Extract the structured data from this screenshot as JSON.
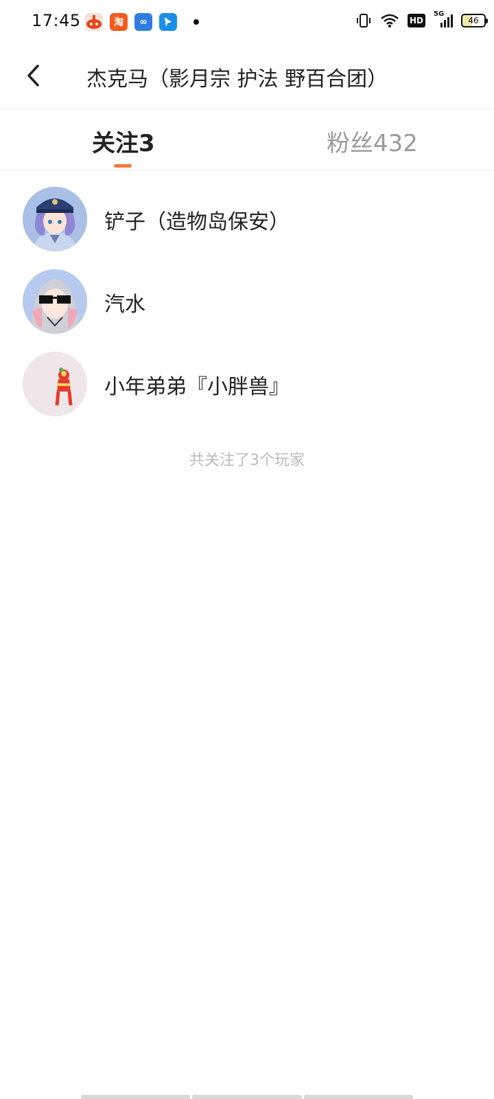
{
  "status_bar": {
    "time": "17:45",
    "notification_icons": [
      "app-notification-icon",
      "taobao-icon",
      "infinity-app-icon",
      "feather-app-icon"
    ],
    "hd_label": "HD",
    "network_label": "5G",
    "battery_level": "46"
  },
  "header": {
    "title": "杰克马（影月宗 护法 野百合团）"
  },
  "tabs": [
    {
      "label": "关注3",
      "active": true
    },
    {
      "label": "粉丝432",
      "active": false
    }
  ],
  "users": [
    {
      "name": "铲子（造物岛保安）",
      "avatar": "anime-girl-police-cap-avatar"
    },
    {
      "name": "汽水",
      "avatar": "anime-girl-sunglasses-avatar"
    },
    {
      "name": "小年弟弟『小胖兽』",
      "avatar": "lion-dance-avatar"
    }
  ],
  "list_footer": "共关注了3个玩家",
  "colors": {
    "accent": "#f07c3e",
    "inactive_tab": "#9a9a9a",
    "footer_text": "#bbbbbb"
  }
}
